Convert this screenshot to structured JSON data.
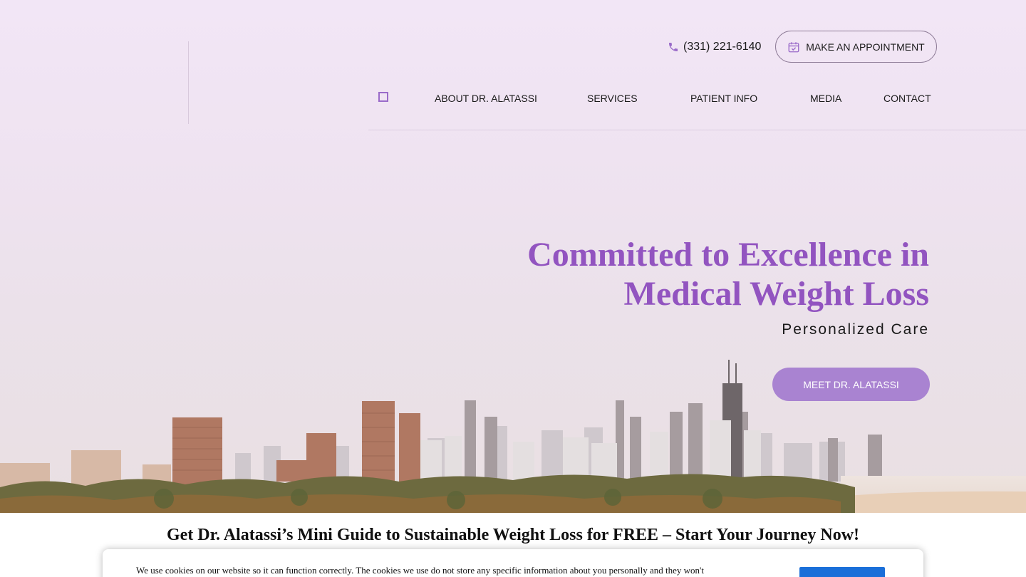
{
  "header": {
    "phone": "(331) 221-6140",
    "appointment_label": "MAKE AN APPOINTMENT",
    "nav_items": [
      "ABOUT DR. ALATASSI",
      "SERVICES",
      "PATIENT INFO",
      "MEDIA",
      "CONTACT"
    ]
  },
  "hero": {
    "headline_line1": "Committed to Excellence in",
    "headline_line2": "Medical Weight Loss",
    "subheadline": "Personalized Care",
    "cta_label": "MEET DR. ALATASSI"
  },
  "guide_banner": "Get Dr. Alatassi’s Mini Guide to Sustainable Weight Loss for FREE – Start Your Journey Now!",
  "cookie_notice": {
    "text": "We use cookies on our website so it can function correctly. The cookies we use do not store any specific information about you personally and they won't"
  },
  "colors": {
    "accent": "#9254c0",
    "button": "#a983d1",
    "cookie_button": "#1a6fd9"
  },
  "icons": {
    "phone": "phone-icon",
    "appointment": "calendar-check-icon",
    "nav": "menu-square-icon"
  }
}
